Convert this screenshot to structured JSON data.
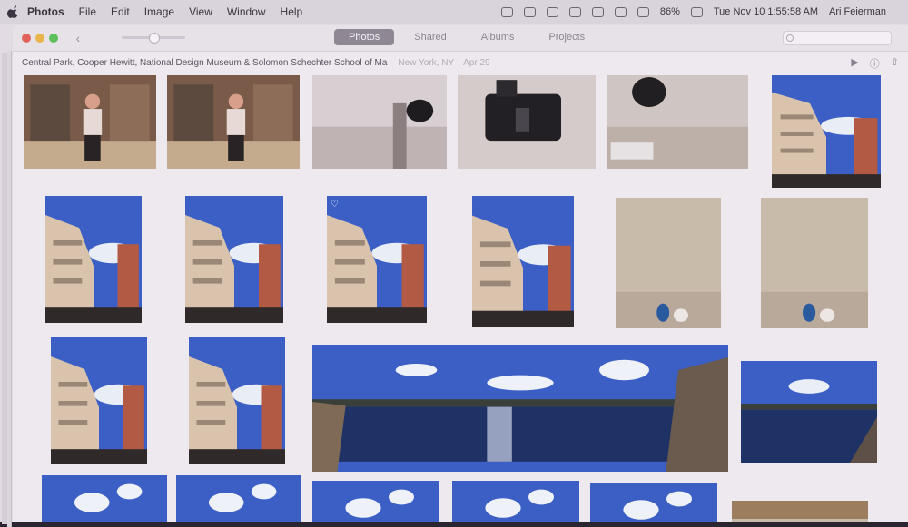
{
  "menubar": {
    "items": [
      "Photos",
      "File",
      "Edit",
      "Image",
      "View",
      "Window",
      "Help"
    ],
    "status": {
      "battery": "86%",
      "datetime": "Tue Nov 10  1:55:58 AM",
      "user": "Ari Feierman"
    }
  },
  "toolbar": {
    "tabs": [
      "Photos",
      "Shared",
      "Albums",
      "Projects"
    ],
    "active_tab": "Photos"
  },
  "moment": {
    "title": "Central Park, Cooper Hewitt, National Design Museum & Solomon Schechter School of Ma",
    "location": "New York, NY",
    "date": "Apr 29"
  },
  "colors": {
    "sky": "#3b5fc4",
    "building": "#d9c3ad",
    "brick": "#b35a45",
    "sand": "#c9bba9",
    "window_bg": "#eee8ef"
  },
  "photos": [
    {
      "kind": "interior-person"
    },
    {
      "kind": "interior-person"
    },
    {
      "kind": "ceiling-object"
    },
    {
      "kind": "camera-object"
    },
    {
      "kind": "table-object"
    },
    {
      "kind": "buildings-sky"
    },
    {
      "kind": "buildings-sky"
    },
    {
      "kind": "buildings-sky"
    },
    {
      "kind": "buildings-sky",
      "favorite": true
    },
    {
      "kind": "buildings-sky"
    },
    {
      "kind": "sand-feet"
    },
    {
      "kind": "sand-feet"
    },
    {
      "kind": "buildings-sky"
    },
    {
      "kind": "buildings-sky"
    },
    {
      "kind": "panorama-reservoir"
    },
    {
      "kind": "reservoir"
    },
    {
      "kind": "sky-bottom"
    },
    {
      "kind": "sky-bottom"
    },
    {
      "kind": "sky-bottom"
    },
    {
      "kind": "sky-bottom"
    },
    {
      "kind": "sky-bottom"
    },
    {
      "kind": "sand-bottom"
    }
  ]
}
